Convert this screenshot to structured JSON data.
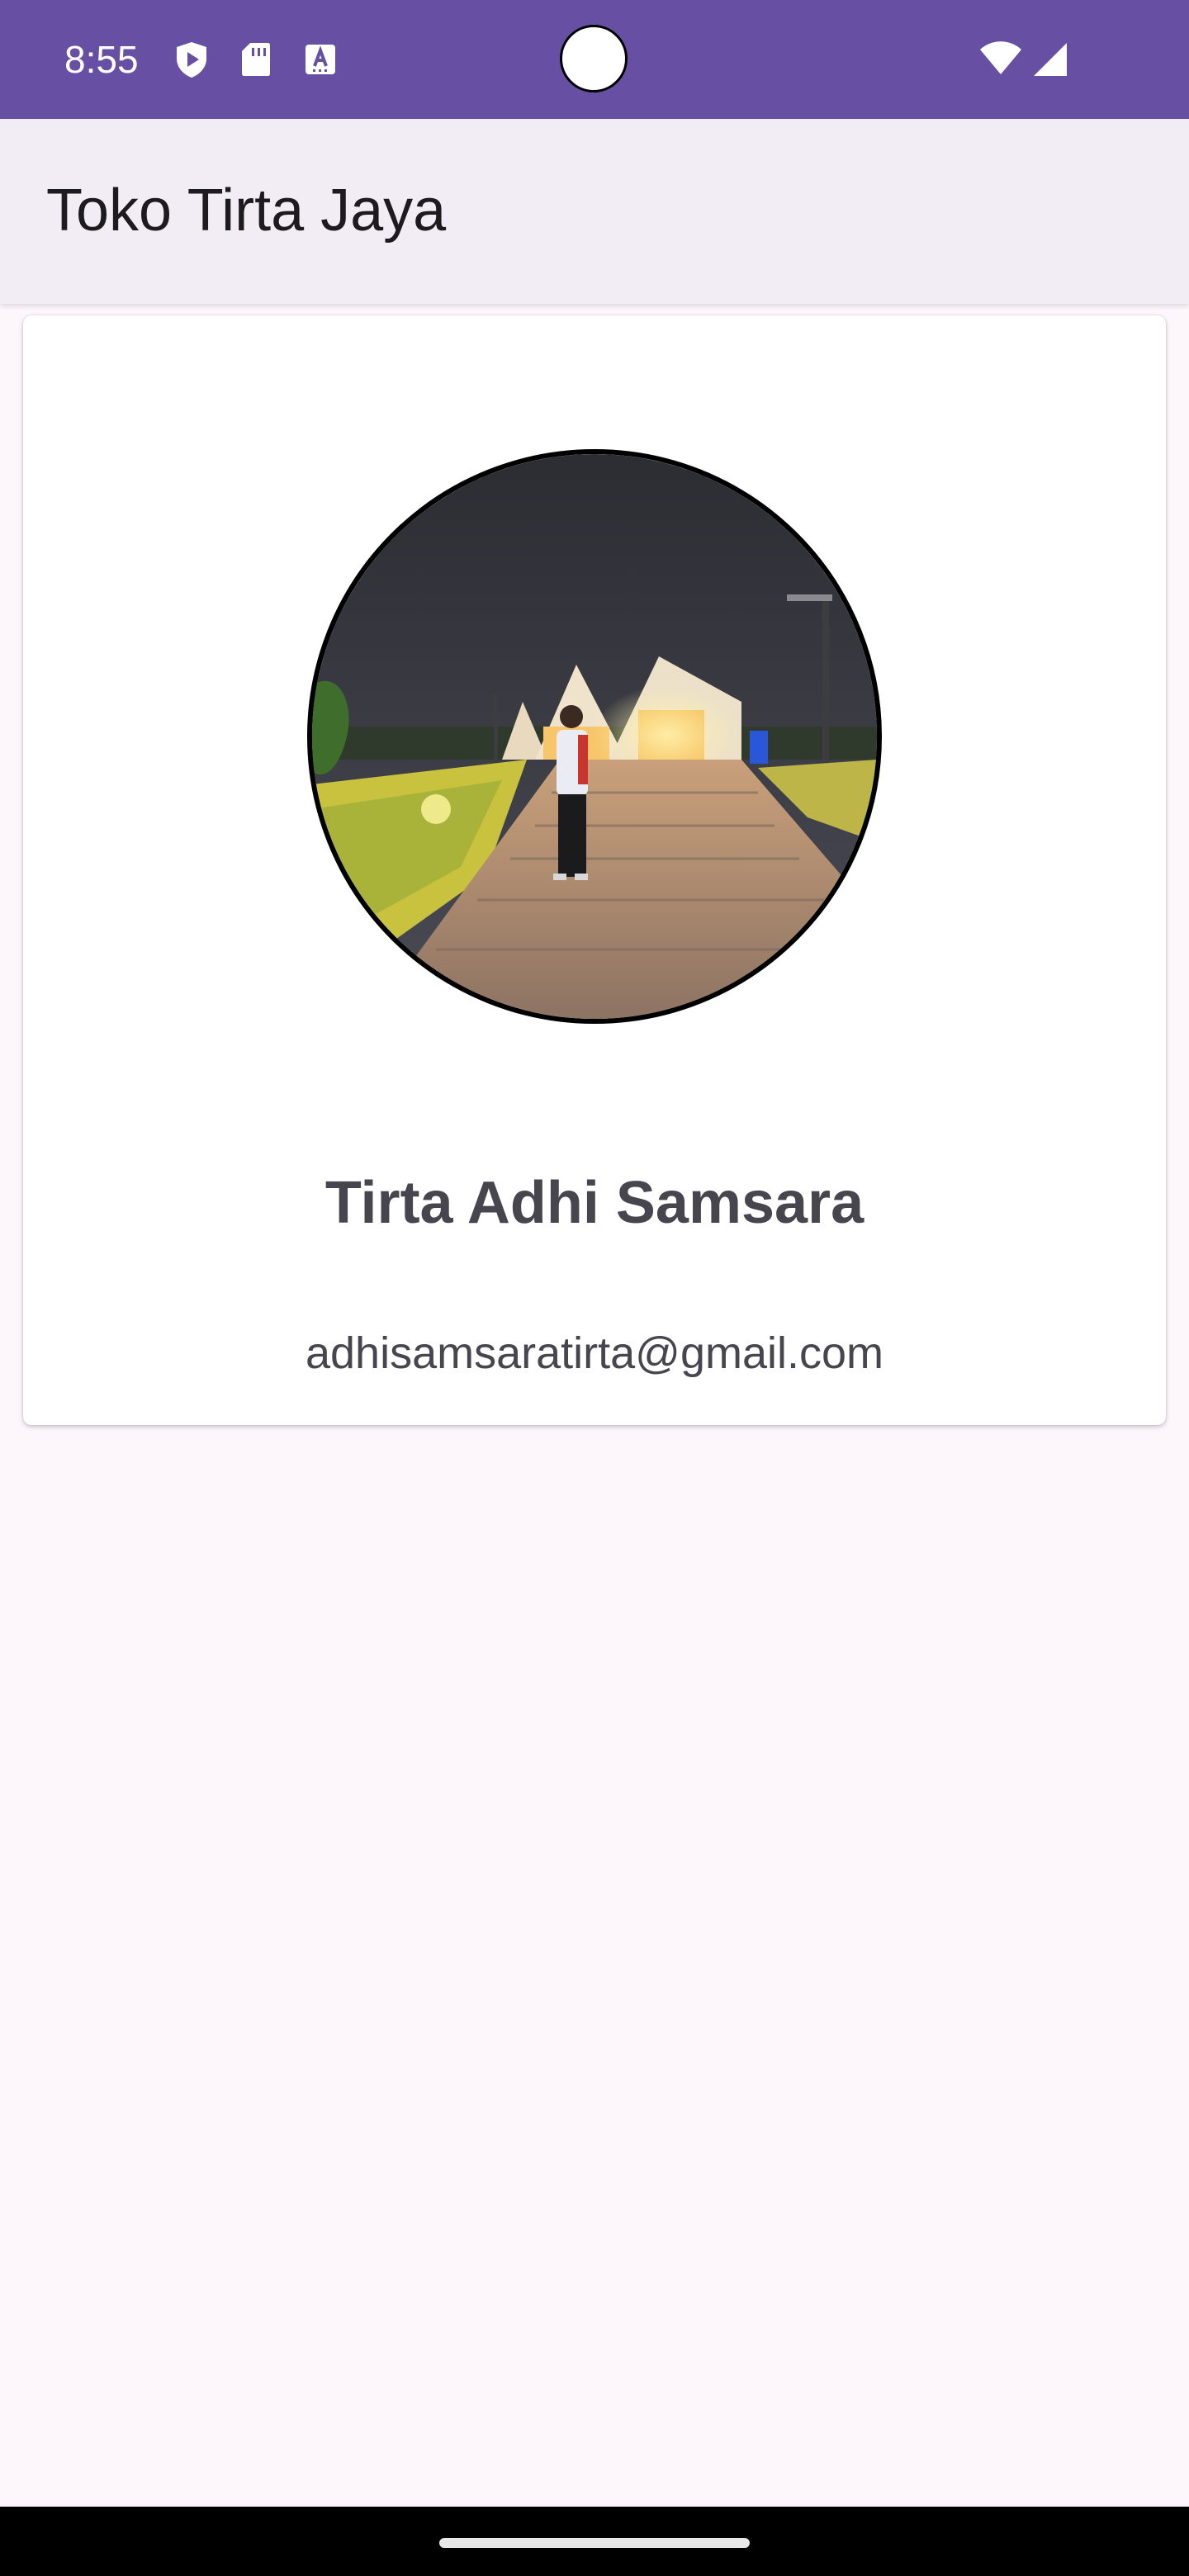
{
  "status_bar": {
    "time": "8:55",
    "background_color": "#6750a4",
    "icons": [
      "play-protect-icon",
      "sd-card-icon",
      "keyboard-a-icon",
      "wifi-icon",
      "signal-icon"
    ]
  },
  "app_bar": {
    "title": "Toko Tirta Jaya",
    "background_color": "#f2edf5"
  },
  "profile": {
    "avatar_description": "profile-photo",
    "name": "Tirta Adhi Samsara",
    "email": "adhisamsaratirta@gmail.com"
  },
  "colors": {
    "page_background": "#fdf7fc",
    "card_background": "#ffffff",
    "text_secondary": "#47464f"
  }
}
